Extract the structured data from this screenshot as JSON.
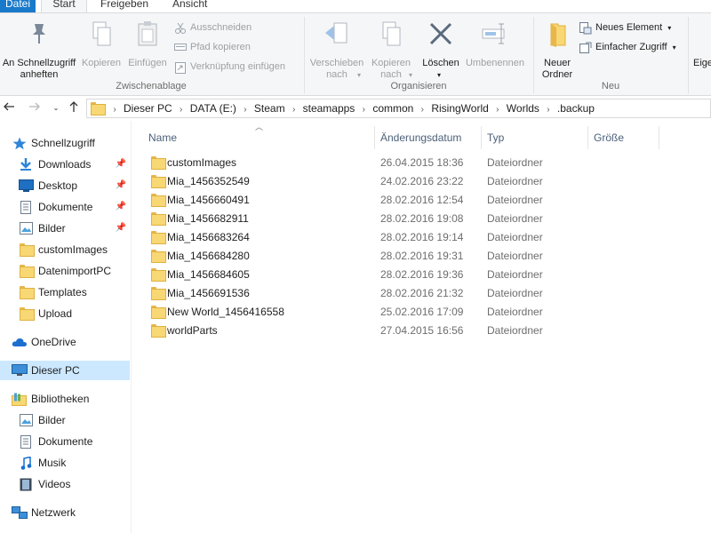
{
  "ribbon": {
    "tabs": {
      "file": "Datei",
      "start": "Start",
      "share": "Freigeben",
      "view": "Ansicht"
    },
    "pin_quick_access": "An Schnellzugriff anheften",
    "copy": "Kopieren",
    "paste": "Einfügen",
    "cut": "Ausschneiden",
    "copy_path": "Pfad kopieren",
    "paste_shortcut": "Verknüpfung einfügen",
    "group_clipboard": "Zwischenablage",
    "move_to": "Verschieben nach",
    "copy_to": "Kopieren nach",
    "delete": "Löschen",
    "rename": "Umbenennen",
    "group_organize": "Organisieren",
    "new_folder": "Neuer Ordner",
    "new_item": "Neues Element",
    "easy_access": "Einfacher Zugriff",
    "group_new": "Neu",
    "properties_partial": "Eige"
  },
  "address": {
    "crumbs": [
      "Dieser PC",
      "DATA (E:)",
      "Steam",
      "steamapps",
      "common",
      "RisingWorld",
      "Worlds",
      ".backup"
    ]
  },
  "sidebar": {
    "quick_access": "Schnellzugriff",
    "downloads": "Downloads",
    "desktop": "Desktop",
    "documents": "Dokumente",
    "pictures": "Bilder",
    "custom_images": "customImages",
    "datenimport": "DatenimportPC",
    "templates": "Templates",
    "upload": "Upload",
    "onedrive": "OneDrive",
    "this_pc": "Dieser PC",
    "libraries": "Bibliotheken",
    "lib_pictures": "Bilder",
    "lib_documents": "Dokumente",
    "lib_music": "Musik",
    "lib_videos": "Videos",
    "network": "Netzwerk"
  },
  "columns": {
    "name": "Name",
    "date": "Änderungsdatum",
    "type": "Typ",
    "size": "Größe"
  },
  "files": [
    {
      "name": "customImages",
      "date": "26.04.2015 18:36",
      "type": "Dateiordner"
    },
    {
      "name": "Mia_1456352549",
      "date": "24.02.2016 23:22",
      "type": "Dateiordner"
    },
    {
      "name": "Mia_1456660491",
      "date": "28.02.2016 12:54",
      "type": "Dateiordner"
    },
    {
      "name": "Mia_1456682911",
      "date": "28.02.2016 19:08",
      "type": "Dateiordner"
    },
    {
      "name": "Mia_1456683264",
      "date": "28.02.2016 19:14",
      "type": "Dateiordner"
    },
    {
      "name": "Mia_1456684280",
      "date": "28.02.2016 19:31",
      "type": "Dateiordner"
    },
    {
      "name": "Mia_1456684605",
      "date": "28.02.2016 19:36",
      "type": "Dateiordner"
    },
    {
      "name": "Mia_1456691536",
      "date": "28.02.2016 21:32",
      "type": "Dateiordner"
    },
    {
      "name": "New World_1456416558",
      "date": "25.02.2016 17:09",
      "type": "Dateiordner"
    },
    {
      "name": "worldParts",
      "date": "27.04.2015 16:56",
      "type": "Dateiordner"
    }
  ],
  "colors": {
    "accent": "#1979ca",
    "selection": "#cce8ff",
    "folder": "#f8d775"
  }
}
